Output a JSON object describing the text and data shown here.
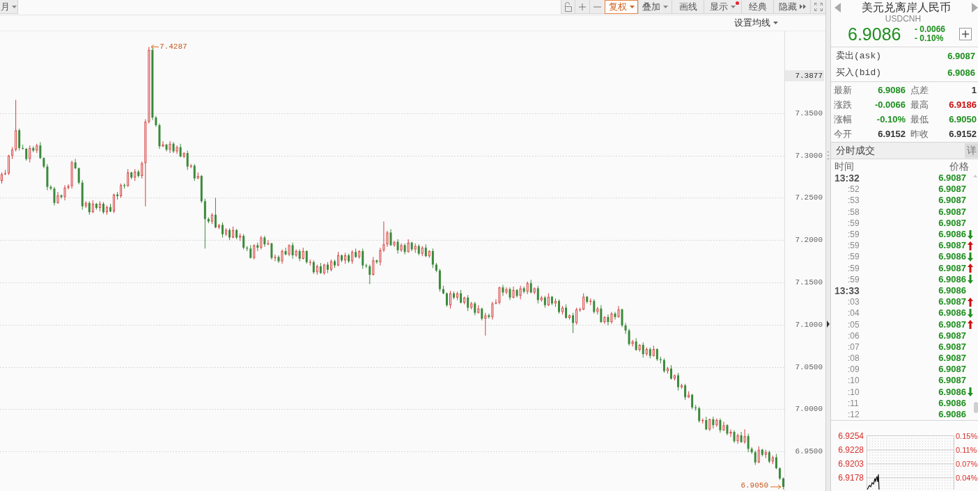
{
  "toolbar": {
    "period_button": {
      "label": "月"
    },
    "buttons": [
      {
        "label": "复权",
        "kind": "dropdown",
        "selected": true,
        "notification": false
      },
      {
        "label": "叠加",
        "kind": "dropdown",
        "selected": false,
        "notification": false
      },
      {
        "label": "画线",
        "kind": "plain",
        "selected": false,
        "notification": false
      },
      {
        "label": "显示",
        "kind": "dropdown",
        "selected": false,
        "notification": true
      },
      {
        "label": "经典",
        "kind": "plain",
        "selected": false,
        "notification": false
      },
      {
        "label": "隐藏",
        "kind": "collapse",
        "selected": false,
        "notification": false
      }
    ]
  },
  "ma_settings": {
    "label": "设置均线"
  },
  "chart": {
    "crosshair_label": "7.3877",
    "high_marker": "7.4287",
    "low_marker": "6.9050",
    "chart_data": {
      "type": "candlestick",
      "grid": true,
      "ylim": [
        6.9031,
        7.4471
      ],
      "yticks": [
        {
          "value": 7.35,
          "label": "7.3500"
        },
        {
          "value": 7.3,
          "label": "7.3000"
        },
        {
          "value": 7.25,
          "label": "7.2500"
        },
        {
          "value": 7.2,
          "label": "7.2000"
        },
        {
          "value": 7.15,
          "label": "7.1500"
        },
        {
          "value": 7.1,
          "label": "7.1000"
        },
        {
          "value": 7.05,
          "label": "7.0500"
        },
        {
          "value": 7.0,
          "label": "7.0000"
        },
        {
          "value": 6.95,
          "label": "6.9500"
        }
      ],
      "ohlc": [
        [
          7.27,
          7.28,
          7.267,
          7.278
        ],
        [
          7.278,
          7.283,
          7.277,
          7.279
        ],
        [
          7.279,
          7.301,
          7.277,
          7.3
        ],
        [
          7.3,
          7.31,
          7.296,
          7.307
        ],
        [
          7.307,
          7.366,
          7.305,
          7.33
        ],
        [
          7.33,
          7.332,
          7.306,
          7.309
        ],
        [
          7.309,
          7.313,
          7.307,
          7.308
        ],
        [
          7.308,
          7.309,
          7.294,
          7.296
        ],
        [
          7.296,
          7.312,
          7.292,
          7.309
        ],
        [
          7.309,
          7.311,
          7.304,
          7.306
        ],
        [
          7.306,
          7.314,
          7.303,
          7.312
        ],
        [
          7.312,
          7.316,
          7.296,
          7.297
        ],
        [
          7.297,
          7.298,
          7.285,
          7.287
        ],
        [
          7.287,
          7.29,
          7.259,
          7.263
        ],
        [
          7.263,
          7.265,
          7.259,
          7.261
        ],
        [
          7.261,
          7.263,
          7.241,
          7.244
        ],
        [
          7.244,
          7.257,
          7.243,
          7.253
        ],
        [
          7.253,
          7.254,
          7.249,
          7.251
        ],
        [
          7.251,
          7.265,
          7.247,
          7.262
        ],
        [
          7.262,
          7.266,
          7.26,
          7.264
        ],
        [
          7.264,
          7.294,
          7.261,
          7.292
        ],
        [
          7.292,
          7.296,
          7.284,
          7.285
        ],
        [
          7.285,
          7.286,
          7.266,
          7.268
        ],
        [
          7.268,
          7.271,
          7.236,
          7.24
        ],
        [
          7.24,
          7.246,
          7.238,
          7.244
        ],
        [
          7.244,
          7.246,
          7.23,
          7.233
        ],
        [
          7.233,
          7.247,
          7.232,
          7.243
        ],
        [
          7.243,
          7.244,
          7.236,
          7.238
        ],
        [
          7.238,
          7.246,
          7.234,
          7.243
        ],
        [
          7.243,
          7.245,
          7.231,
          7.233
        ],
        [
          7.233,
          7.241,
          7.23,
          7.239
        ],
        [
          7.239,
          7.243,
          7.233,
          7.234
        ],
        [
          7.234,
          7.255,
          7.232,
          7.254
        ],
        [
          7.254,
          7.257,
          7.248,
          7.252
        ],
        [
          7.252,
          7.267,
          7.25,
          7.265
        ],
        [
          7.265,
          7.267,
          7.261,
          7.264
        ],
        [
          7.264,
          7.284,
          7.263,
          7.28
        ],
        [
          7.28,
          7.281,
          7.272,
          7.274
        ],
        [
          7.274,
          7.284,
          7.27,
          7.281
        ],
        [
          7.281,
          7.283,
          7.274,
          7.276
        ],
        [
          7.276,
          7.293,
          7.273,
          7.291
        ],
        [
          7.291,
          7.343,
          7.24,
          7.34
        ],
        [
          7.34,
          7.4287,
          7.338,
          7.425
        ],
        [
          7.425,
          7.427,
          7.342,
          7.345
        ],
        [
          7.345,
          7.347,
          7.334,
          7.336
        ],
        [
          7.336,
          7.338,
          7.308,
          7.311
        ],
        [
          7.311,
          7.317,
          7.31,
          7.313
        ],
        [
          7.313,
          7.314,
          7.305,
          7.307
        ],
        [
          7.307,
          7.317,
          7.303,
          7.314
        ],
        [
          7.314,
          7.316,
          7.303,
          7.305
        ],
        [
          7.305,
          7.312,
          7.302,
          7.31
        ],
        [
          7.31,
          7.314,
          7.298,
          7.299
        ],
        [
          7.299,
          7.304,
          7.297,
          7.303
        ],
        [
          7.303,
          7.306,
          7.283,
          7.287
        ],
        [
          7.287,
          7.29,
          7.285,
          7.288
        ],
        [
          7.288,
          7.29,
          7.27,
          7.273
        ],
        [
          7.273,
          7.28,
          7.272,
          7.276
        ],
        [
          7.276,
          7.277,
          7.244,
          7.246
        ],
        [
          7.246,
          7.249,
          7.19,
          7.225
        ],
        [
          7.225,
          7.227,
          7.22,
          7.222
        ],
        [
          7.222,
          7.232,
          7.219,
          7.23
        ],
        [
          7.23,
          7.25,
          7.214,
          7.215
        ],
        [
          7.215,
          7.219,
          7.213,
          7.218
        ],
        [
          7.218,
          7.221,
          7.203,
          7.207
        ],
        [
          7.207,
          7.214,
          7.205,
          7.212
        ],
        [
          7.212,
          7.214,
          7.2,
          7.203
        ],
        [
          7.203,
          7.216,
          7.202,
          7.212
        ],
        [
          7.212,
          7.213,
          7.201,
          7.203
        ],
        [
          7.203,
          7.208,
          7.199,
          7.205
        ],
        [
          7.205,
          7.207,
          7.189,
          7.191
        ],
        [
          7.191,
          7.193,
          7.187,
          7.19
        ],
        [
          7.19,
          7.194,
          7.178,
          7.179
        ],
        [
          7.179,
          7.195,
          7.177,
          7.194
        ],
        [
          7.194,
          7.197,
          7.187,
          7.191
        ],
        [
          7.191,
          7.205,
          7.189,
          7.203
        ],
        [
          7.203,
          7.205,
          7.192,
          7.195
        ],
        [
          7.195,
          7.2,
          7.194,
          7.196
        ],
        [
          7.196,
          7.197,
          7.177,
          7.179
        ],
        [
          7.179,
          7.183,
          7.175,
          7.18
        ],
        [
          7.18,
          7.182,
          7.173,
          7.175
        ],
        [
          7.175,
          7.189,
          7.172,
          7.187
        ],
        [
          7.187,
          7.191,
          7.182,
          7.183
        ],
        [
          7.183,
          7.195,
          7.181,
          7.194
        ],
        [
          7.194,
          7.197,
          7.178,
          7.182
        ],
        [
          7.182,
          7.189,
          7.18,
          7.187
        ],
        [
          7.187,
          7.189,
          7.175,
          7.178
        ],
        [
          7.178,
          7.191,
          7.177,
          7.187
        ],
        [
          7.187,
          7.188,
          7.172,
          7.174
        ],
        [
          7.174,
          7.177,
          7.17,
          7.174
        ],
        [
          7.174,
          7.176,
          7.16,
          7.162
        ],
        [
          7.162,
          7.171,
          7.159,
          7.169
        ],
        [
          7.169,
          7.173,
          7.16,
          7.161
        ],
        [
          7.161,
          7.172,
          7.159,
          7.171
        ],
        [
          7.171,
          7.174,
          7.161,
          7.165
        ],
        [
          7.165,
          7.177,
          7.163,
          7.175
        ],
        [
          7.175,
          7.177,
          7.167,
          7.17
        ],
        [
          7.17,
          7.186,
          7.169,
          7.182
        ],
        [
          7.182,
          7.183,
          7.174,
          7.176
        ],
        [
          7.176,
          7.185,
          7.172,
          7.182
        ],
        [
          7.182,
          7.184,
          7.173,
          7.175
        ],
        [
          7.175,
          7.188,
          7.172,
          7.186
        ],
        [
          7.186,
          7.19,
          7.179,
          7.18
        ],
        [
          7.18,
          7.188,
          7.178,
          7.187
        ],
        [
          7.187,
          7.19,
          7.166,
          7.17
        ],
        [
          7.17,
          7.172,
          7.167,
          7.169
        ],
        [
          7.169,
          7.171,
          7.148,
          7.159
        ],
        [
          7.159,
          7.18,
          7.158,
          7.176
        ],
        [
          7.176,
          7.177,
          7.172,
          7.174
        ],
        [
          7.174,
          7.191,
          7.17,
          7.188
        ],
        [
          7.188,
          7.222,
          7.186,
          7.195
        ],
        [
          7.195,
          7.211,
          7.192,
          7.209
        ],
        [
          7.209,
          7.213,
          7.193,
          7.194
        ],
        [
          7.194,
          7.199,
          7.192,
          7.198
        ],
        [
          7.198,
          7.201,
          7.184,
          7.188
        ],
        [
          7.188,
          7.196,
          7.186,
          7.194
        ],
        [
          7.194,
          7.196,
          7.183,
          7.186
        ],
        [
          7.186,
          7.201,
          7.185,
          7.197
        ],
        [
          7.197,
          7.198,
          7.187,
          7.189
        ],
        [
          7.189,
          7.196,
          7.185,
          7.193
        ],
        [
          7.193,
          7.195,
          7.182,
          7.184
        ],
        [
          7.184,
          7.193,
          7.181,
          7.191
        ],
        [
          7.191,
          7.195,
          7.18,
          7.181
        ],
        [
          7.181,
          7.188,
          7.179,
          7.187
        ],
        [
          7.187,
          7.19,
          7.167,
          7.171
        ],
        [
          7.171,
          7.173,
          7.162,
          7.164
        ],
        [
          7.164,
          7.166,
          7.139,
          7.142
        ],
        [
          7.142,
          7.146,
          7.136,
          7.137
        ],
        [
          7.137,
          7.138,
          7.121,
          7.123
        ],
        [
          7.123,
          7.14,
          7.119,
          7.137
        ],
        [
          7.137,
          7.139,
          7.13,
          7.132
        ],
        [
          7.132,
          7.139,
          7.129,
          7.137
        ],
        [
          7.137,
          7.141,
          7.125,
          7.126
        ],
        [
          7.126,
          7.133,
          7.124,
          7.132
        ],
        [
          7.132,
          7.135,
          7.116,
          7.12
        ],
        [
          7.12,
          7.127,
          7.118,
          7.125
        ],
        [
          7.125,
          7.127,
          7.111,
          7.114
        ],
        [
          7.114,
          7.123,
          7.113,
          7.119
        ],
        [
          7.119,
          7.12,
          7.105,
          7.107
        ],
        [
          7.107,
          7.114,
          7.087,
          7.111
        ],
        [
          7.111,
          7.113,
          7.107,
          7.109
        ],
        [
          7.109,
          7.127,
          7.106,
          7.125
        ],
        [
          7.125,
          7.13,
          7.124,
          7.126
        ],
        [
          7.126,
          7.145,
          7.124,
          7.144
        ],
        [
          7.144,
          7.147,
          7.134,
          7.138
        ],
        [
          7.138,
          7.144,
          7.136,
          7.142
        ],
        [
          7.142,
          7.144,
          7.129,
          7.132
        ],
        [
          7.132,
          7.145,
          7.131,
          7.141
        ],
        [
          7.141,
          7.142,
          7.132,
          7.134
        ],
        [
          7.134,
          7.146,
          7.13,
          7.143
        ],
        [
          7.143,
          7.145,
          7.137,
          7.139
        ],
        [
          7.139,
          7.151,
          7.136,
          7.149
        ],
        [
          7.149,
          7.153,
          7.137,
          7.138
        ],
        [
          7.138,
          7.144,
          7.136,
          7.143
        ],
        [
          7.143,
          7.146,
          7.125,
          7.129
        ],
        [
          7.129,
          7.134,
          7.127,
          7.132
        ],
        [
          7.132,
          7.134,
          7.12,
          7.123
        ],
        [
          7.123,
          7.137,
          7.122,
          7.133
        ],
        [
          7.133,
          7.134,
          7.123,
          7.125
        ],
        [
          7.125,
          7.131,
          7.121,
          7.128
        ],
        [
          7.128,
          7.13,
          7.113,
          7.115
        ],
        [
          7.115,
          7.122,
          7.112,
          7.12
        ],
        [
          7.12,
          7.124,
          7.107,
          7.108
        ],
        [
          7.108,
          7.112,
          7.106,
          7.111
        ],
        [
          7.111,
          7.114,
          7.09,
          7.102
        ],
        [
          7.102,
          7.12,
          7.1,
          7.118
        ],
        [
          7.118,
          7.12,
          7.115,
          7.118
        ],
        [
          7.118,
          7.137,
          7.117,
          7.133
        ],
        [
          7.133,
          7.134,
          7.125,
          7.127
        ],
        [
          7.127,
          7.131,
          7.123,
          7.128
        ],
        [
          7.128,
          7.13,
          7.113,
          7.115
        ],
        [
          7.115,
          7.121,
          7.112,
          7.119
        ],
        [
          7.119,
          7.123,
          7.102,
          7.103
        ],
        [
          7.103,
          7.11,
          7.101,
          7.109
        ],
        [
          7.109,
          7.112,
          7.099,
          7.103
        ],
        [
          7.103,
          7.115,
          7.101,
          7.113
        ],
        [
          7.113,
          7.115,
          7.106,
          7.109
        ],
        [
          7.109,
          7.122,
          7.108,
          7.118
        ],
        [
          7.118,
          7.119,
          7.097,
          7.099
        ],
        [
          7.099,
          7.102,
          7.089,
          7.093
        ],
        [
          7.093,
          7.095,
          7.075,
          7.077
        ],
        [
          7.077,
          7.082,
          7.074,
          7.08
        ],
        [
          7.08,
          7.084,
          7.069,
          7.07
        ],
        [
          7.07,
          7.077,
          7.068,
          7.076
        ],
        [
          7.076,
          7.079,
          7.061,
          7.065
        ],
        [
          7.065,
          7.073,
          7.063,
          7.071
        ],
        [
          7.071,
          7.073,
          7.06,
          7.063
        ],
        [
          7.063,
          7.075,
          7.062,
          7.071
        ],
        [
          7.071,
          7.072,
          7.057,
          7.059
        ],
        [
          7.059,
          7.062,
          7.054,
          7.058
        ],
        [
          7.058,
          7.06,
          7.043,
          7.045
        ],
        [
          7.045,
          7.05,
          7.042,
          7.048
        ],
        [
          7.048,
          7.052,
          7.035,
          7.036
        ],
        [
          7.036,
          7.041,
          7.034,
          7.04
        ],
        [
          7.04,
          7.043,
          7.022,
          7.026
        ],
        [
          7.026,
          7.03,
          7.024,
          7.028
        ],
        [
          7.028,
          7.03,
          7.011,
          7.014
        ],
        [
          7.014,
          7.021,
          7.013,
          7.017
        ],
        [
          7.017,
          7.018,
          7.0,
          7.002
        ],
        [
          7.002,
          7.005,
          6.998,
          7.001
        ],
        [
          7.001,
          7.003,
          6.984,
          6.986
        ],
        [
          6.986,
          6.989,
          6.983,
          6.987
        ],
        [
          6.987,
          6.991,
          6.975,
          6.976
        ],
        [
          6.976,
          6.989,
          6.974,
          6.988
        ],
        [
          6.988,
          6.991,
          6.977,
          6.981
        ],
        [
          6.981,
          6.989,
          6.979,
          6.987
        ],
        [
          6.987,
          6.989,
          6.972,
          6.975
        ],
        [
          6.975,
          6.985,
          6.974,
          6.981
        ],
        [
          6.981,
          6.982,
          6.969,
          6.971
        ],
        [
          6.971,
          6.976,
          6.967,
          6.973
        ],
        [
          6.973,
          6.975,
          6.96,
          6.962
        ],
        [
          6.962,
          6.971,
          6.959,
          6.969
        ],
        [
          6.969,
          6.973,
          6.96,
          6.961
        ],
        [
          6.961,
          6.976,
          6.959,
          6.968
        ],
        [
          6.968,
          6.971,
          6.949,
          6.953
        ],
        [
          6.953,
          6.955,
          6.947,
          6.949
        ],
        [
          6.949,
          6.951,
          6.934,
          6.937
        ],
        [
          6.937,
          6.956,
          6.936,
          6.952
        ],
        [
          6.952,
          6.953,
          6.944,
          6.946
        ],
        [
          6.946,
          6.952,
          6.942,
          6.949
        ],
        [
          6.949,
          6.951,
          6.936,
          6.938
        ],
        [
          6.938,
          6.945,
          6.935,
          6.943
        ],
        [
          6.943,
          6.947,
          6.929,
          6.93
        ],
        [
          6.93,
          6.931,
          6.916,
          6.918
        ],
        [
          6.918,
          6.919,
          6.905,
          6.908
        ]
      ]
    }
  },
  "quote": {
    "title": "美元兑离岸人民币",
    "symbol": "USDCNH",
    "price": "6.9086",
    "change": "- 0.0066",
    "change_pct": "- 0.10%",
    "color": "#1e8f1e"
  },
  "ask_bid": [
    {
      "label": "卖出(ask)",
      "value": "6.9087",
      "color": "#1e8f1e"
    },
    {
      "label": "买入(bid)",
      "value": "6.9086",
      "color": "#1e8f1e"
    }
  ],
  "stats": [
    {
      "label": "最新",
      "value": "6.9086",
      "color": "#1e8f1e"
    },
    {
      "label": "点差",
      "value": "1",
      "color": "#333333"
    },
    {
      "label": "涨跌",
      "value": "-0.0066",
      "color": "#1e8f1e"
    },
    {
      "label": "最高",
      "value": "6.9186",
      "color": "#cc1010"
    },
    {
      "label": "涨幅",
      "value": "-0.10%",
      "color": "#1e8f1e"
    },
    {
      "label": "最低",
      "value": "6.9050",
      "color": "#1e8f1e"
    },
    {
      "label": "今开",
      "value": "6.9152",
      "color": "#333333"
    },
    {
      "label": "昨收",
      "value": "6.9152",
      "color": "#333333"
    }
  ],
  "trades": {
    "title": "分时成交",
    "detail_button": "详",
    "columns": [
      "时间",
      "价格"
    ],
    "rows": [
      {
        "time": "13:32",
        "kind": "minute",
        "price": "6.9087",
        "uptick": false,
        "downtick": false
      },
      {
        "time": ":52",
        "kind": "second",
        "price": "6.9087",
        "uptick": false,
        "downtick": false
      },
      {
        "time": ":53",
        "kind": "second",
        "price": "6.9087",
        "uptick": false,
        "downtick": false
      },
      {
        "time": ":58",
        "kind": "second",
        "price": "6.9087",
        "uptick": false,
        "downtick": false
      },
      {
        "time": ":59",
        "kind": "second",
        "price": "6.9087",
        "uptick": false,
        "downtick": false
      },
      {
        "time": ":59",
        "kind": "second",
        "price": "6.9086",
        "uptick": false,
        "downtick": true
      },
      {
        "time": ":59",
        "kind": "second",
        "price": "6.9087",
        "uptick": true,
        "downtick": false
      },
      {
        "time": ":59",
        "kind": "second",
        "price": "6.9086",
        "uptick": false,
        "downtick": true
      },
      {
        "time": ":59",
        "kind": "second",
        "price": "6.9087",
        "uptick": true,
        "downtick": false
      },
      {
        "time": ":59",
        "kind": "second",
        "price": "6.9086",
        "uptick": false,
        "downtick": true
      },
      {
        "time": "13:33",
        "kind": "minute",
        "price": "6.9086",
        "uptick": false,
        "downtick": false
      },
      {
        "time": ":03",
        "kind": "second",
        "price": "6.9087",
        "uptick": true,
        "downtick": false
      },
      {
        "time": ":04",
        "kind": "second",
        "price": "6.9086",
        "uptick": false,
        "downtick": true
      },
      {
        "time": ":05",
        "kind": "second",
        "price": "6.9087",
        "uptick": true,
        "downtick": false
      },
      {
        "time": ":06",
        "kind": "second",
        "price": "6.9087",
        "uptick": false,
        "downtick": false
      },
      {
        "time": ":07",
        "kind": "second",
        "price": "6.9087",
        "uptick": false,
        "downtick": false
      },
      {
        "time": ":08",
        "kind": "second",
        "price": "6.9087",
        "uptick": false,
        "downtick": false
      },
      {
        "time": ":09",
        "kind": "second",
        "price": "6.9087",
        "uptick": false,
        "downtick": false
      },
      {
        "time": ":10",
        "kind": "second",
        "price": "6.9087",
        "uptick": false,
        "downtick": false
      },
      {
        "time": ":10",
        "kind": "second",
        "price": "6.9086",
        "uptick": false,
        "downtick": true
      },
      {
        "time": ":11",
        "kind": "second",
        "price": "6.9086",
        "uptick": false,
        "downtick": false
      },
      {
        "time": ":12",
        "kind": "second",
        "price": "6.9086",
        "uptick": false,
        "downtick": false
      }
    ]
  },
  "mini_chart": {
    "price_labels": [
      "6.9254",
      "6.9228",
      "6.9203",
      "6.9178"
    ],
    "percent_labels": [
      "0.15%",
      "0.11%",
      "0.07%",
      "0.04%"
    ]
  }
}
